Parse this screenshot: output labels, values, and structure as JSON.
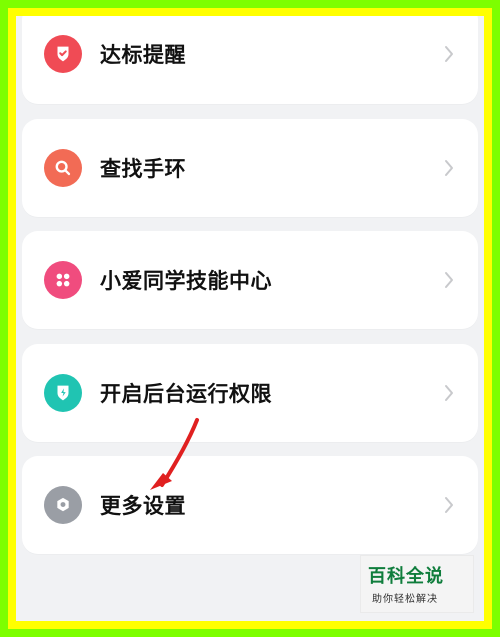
{
  "items": [
    {
      "label": "达标提醒",
      "icon": "shield-check-icon",
      "color": "#f04b55"
    },
    {
      "label": "查找手环",
      "icon": "search-icon",
      "color": "#f26b55"
    },
    {
      "label": "小爱同学技能中心",
      "icon": "apps-grid-icon",
      "color": "#f04c7e"
    },
    {
      "label": "开启后台运行权限",
      "icon": "shield-bolt-icon",
      "color": "#20c4b2"
    },
    {
      "label": "更多设置",
      "icon": "settings-icon",
      "color": "#9a9ea5"
    }
  ],
  "watermark": {
    "title": "百科全说",
    "subtitle": "助你轻松解决"
  }
}
